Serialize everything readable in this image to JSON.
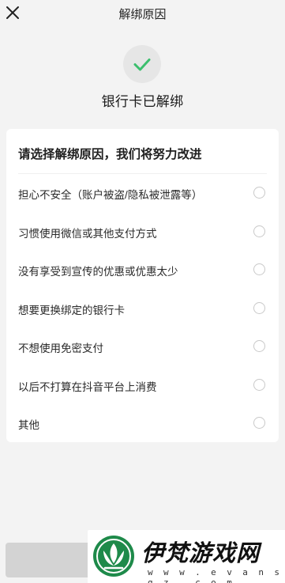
{
  "header": {
    "title": "解绑原因",
    "close_icon": "close-icon"
  },
  "status": {
    "icon": "check-icon",
    "text": "银行卡已解绑",
    "accent_color": "#3cbf6e"
  },
  "reasons": {
    "title": "请选择解绑原因，我们将努力改进",
    "options": [
      {
        "label": "担心不安全（账户被盗/隐私被泄露等）",
        "selected": false
      },
      {
        "label": "习惯使用微信或其他支付方式",
        "selected": false
      },
      {
        "label": "没有享受到宣传的优惠或优惠太少",
        "selected": false
      },
      {
        "label": "想要更换绑定的银行卡",
        "selected": false
      },
      {
        "label": "不想使用免密支付",
        "selected": false
      },
      {
        "label": "以后不打算在抖音平台上消费",
        "selected": false
      },
      {
        "label": "其他",
        "selected": false
      }
    ]
  },
  "footer": {
    "submit_button": {
      "state": "disabled",
      "color": "#d3d3d3"
    }
  },
  "watermark": {
    "name": "伊梵游戏网",
    "url": "w w w . e v a n s g z . c o m",
    "logo_color": "#1e8a4a"
  }
}
